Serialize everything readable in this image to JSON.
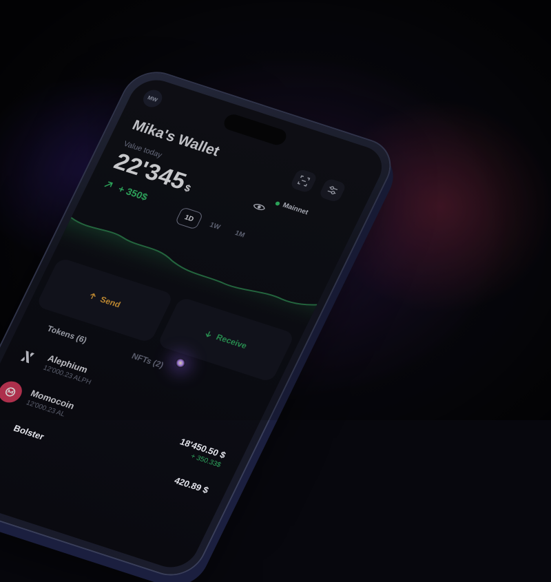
{
  "header": {
    "avatar_initials": "MW",
    "wallet_title": "Mika's Wallet",
    "scan_icon": "scan-icon",
    "settings_icon": "sliders-icon"
  },
  "balance": {
    "label": "Value today",
    "amount": "22'345",
    "unit": "$",
    "network": "Mainnet",
    "change": "+ 350$"
  },
  "periods": [
    {
      "label": "1D",
      "active": true
    },
    {
      "label": "1W",
      "active": false
    },
    {
      "label": "1M",
      "active": false
    }
  ],
  "actions": {
    "send": "Send",
    "receive": "Receive"
  },
  "tabs": {
    "tokens": "Tokens (6)",
    "nfts": "NFTs (2)"
  },
  "tokens": [
    {
      "name": "Alephium",
      "amount": "12'000.23 ALPH",
      "value": "",
      "delta": "",
      "icon": "alephium-icon"
    },
    {
      "name": "Momocoin",
      "amount": "12'000.23 AL",
      "value": "18'450.50 $",
      "delta": "+ 350.33$",
      "icon": "momocoin-icon"
    },
    {
      "name": "Bolster",
      "amount": "",
      "value": "420.89 $",
      "delta": "",
      "icon": "gauge-icon"
    }
  ],
  "colors": {
    "positive": "#34c46b",
    "send": "#e1a23a",
    "chart_line": "#2b7a4b"
  }
}
